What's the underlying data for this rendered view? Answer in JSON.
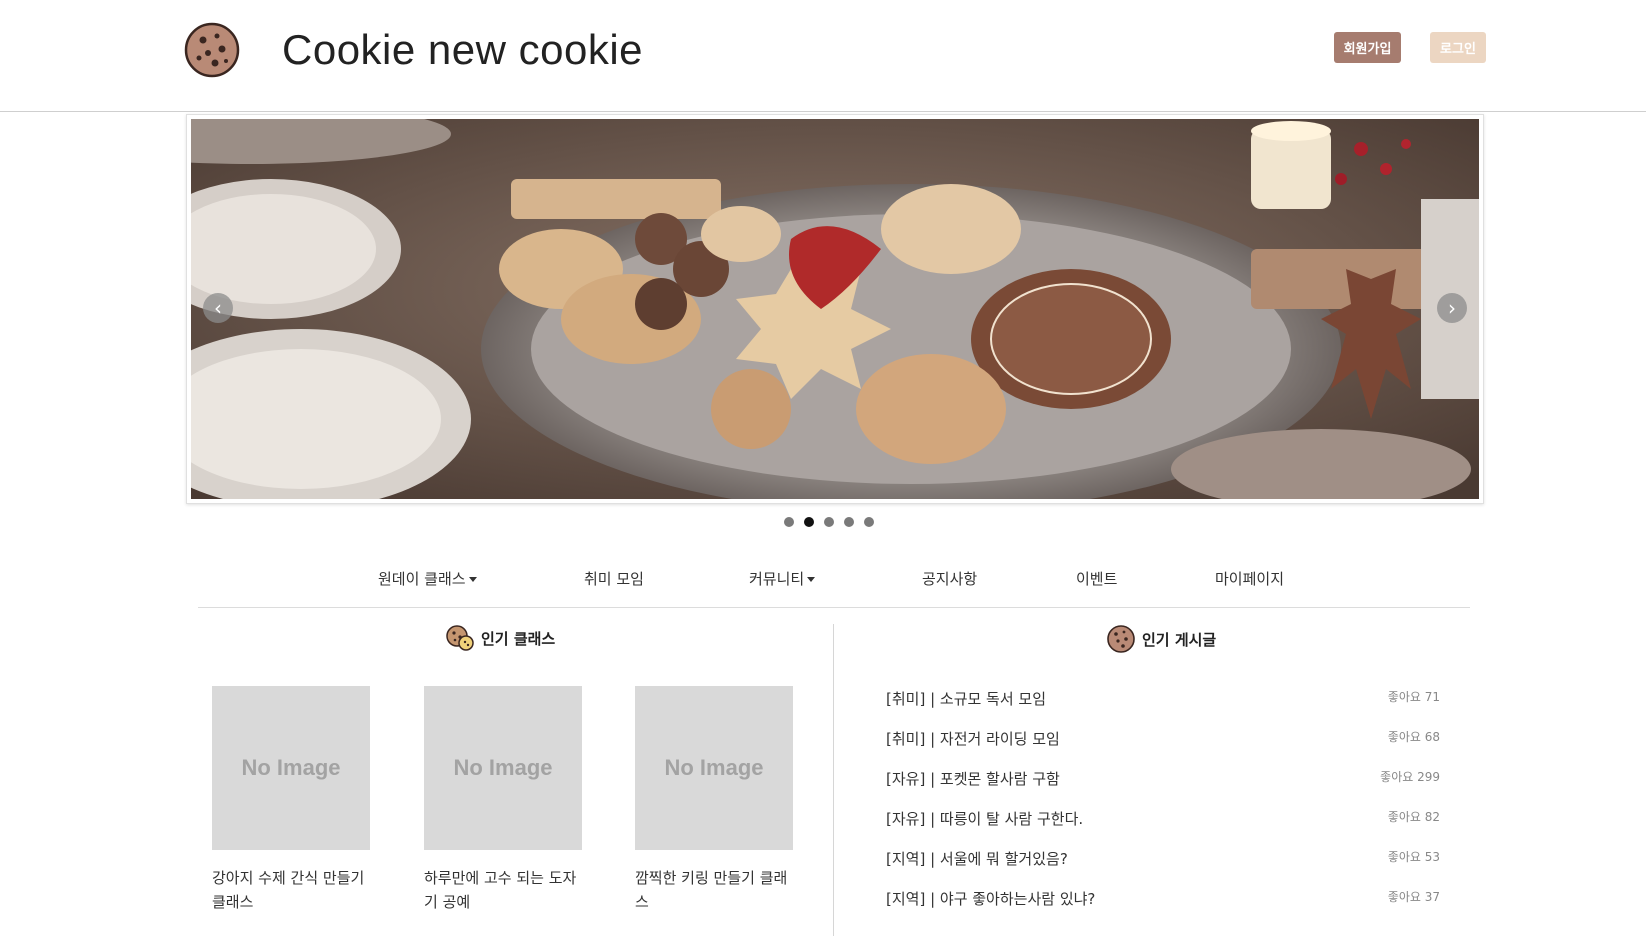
{
  "header": {
    "title": "Cookie new cookie",
    "logo_icon": "cookie-icon",
    "signup_label": "회원가입",
    "login_label": "로그인",
    "signup_color": "#a67c6f",
    "login_color": "#ecd6c2"
  },
  "carousel": {
    "image": "cookie-platter-photo",
    "slide_count": 5,
    "active_index": 1
  },
  "nav": {
    "items": [
      {
        "label": "원데이 클래스",
        "dropdown": true
      },
      {
        "label": "취미 모임",
        "dropdown": false
      },
      {
        "label": "커뮤니티",
        "dropdown": true
      },
      {
        "label": "공지사항",
        "dropdown": false
      },
      {
        "label": "이벤트",
        "dropdown": false
      },
      {
        "label": "마이페이지",
        "dropdown": false
      }
    ]
  },
  "popular_classes": {
    "title": "인기 클래스",
    "icon": "cookies-icon",
    "items": [
      {
        "image_text": "No Image",
        "title": "강아지 수제 간식 만들기 클래스"
      },
      {
        "image_text": "No Image",
        "title": "하루만에 고수 되는 도자기 공예"
      },
      {
        "image_text": "No Image",
        "title": "깜찍한 키링 만들기 클래스"
      }
    ]
  },
  "popular_posts": {
    "title": "인기 게시글",
    "icon": "cookie-icon",
    "items": [
      {
        "title": "[취미] | 소규모 독서 모임",
        "likes": "좋아요 71"
      },
      {
        "title": "[취미] | 자전거 라이딩 모임",
        "likes": "좋아요 68"
      },
      {
        "title": "[자유] | 포켓몬 할사람 구함",
        "likes": "좋아요 299"
      },
      {
        "title": "[자유] | 따릉이 탈 사람 구한다.",
        "likes": "좋아요 82"
      },
      {
        "title": "[지역] | 서울에 뭐 할거있음?",
        "likes": "좋아요 53"
      },
      {
        "title": "[지역] | 야구 좋아하는사람 있냐?",
        "likes": "좋아요 37"
      }
    ]
  }
}
